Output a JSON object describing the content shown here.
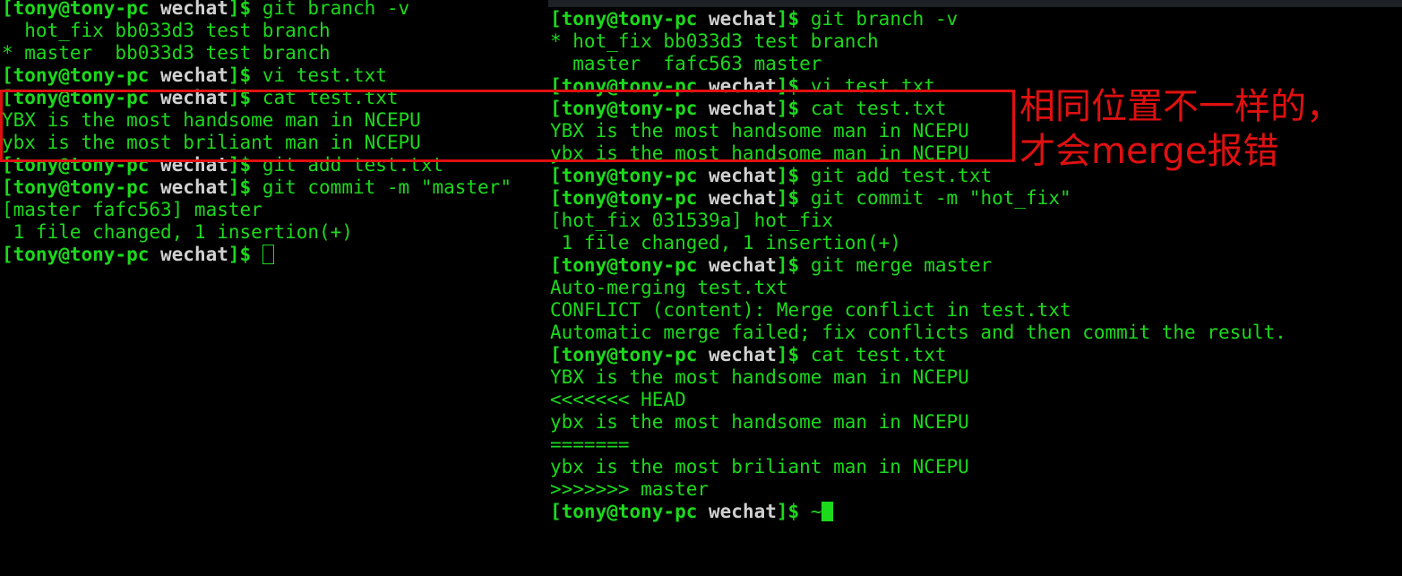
{
  "prompt": {
    "user_host": "[tony@tony-pc ",
    "dir": "wechat",
    "suffix": "]$ "
  },
  "left_terminal": {
    "lines": [
      {
        "type": "prompt",
        "cmd": "git branch -v"
      },
      {
        "type": "out",
        "text": "  hot_fix bb033d3 test branch"
      },
      {
        "type": "out",
        "text": "* master  bb033d3 test branch"
      },
      {
        "type": "prompt",
        "cmd": "vi test.txt"
      },
      {
        "type": "prompt",
        "cmd": "cat test.txt"
      },
      {
        "type": "out",
        "text": "YBX is the most handsome man in NCEPU"
      },
      {
        "type": "out",
        "text": "ybx is the most briliant man in NCEPU"
      },
      {
        "type": "prompt",
        "cmd": "git add test.txt"
      },
      {
        "type": "prompt",
        "cmd": "git commit -m \"master\""
      },
      {
        "type": "out",
        "text": "[master fafc563] master"
      },
      {
        "type": "out",
        "text": " 1 file changed, 1 insertion(+)"
      },
      {
        "type": "prompt",
        "cmd": "",
        "cursor": "hollow"
      }
    ]
  },
  "right_terminal": {
    "lines": [
      {
        "type": "prompt",
        "cmd": "git branch -v"
      },
      {
        "type": "out",
        "text": "* hot_fix bb033d3 test branch"
      },
      {
        "type": "out",
        "text": "  master  fafc563 master"
      },
      {
        "type": "prompt",
        "cmd": "vi test.txt"
      },
      {
        "type": "prompt",
        "cmd": "cat test.txt"
      },
      {
        "type": "out",
        "text": "YBX is the most handsome man in NCEPU"
      },
      {
        "type": "out",
        "text": "ybx is the most handsome man in NCEPU"
      },
      {
        "type": "prompt",
        "cmd": "git add test.txt"
      },
      {
        "type": "prompt",
        "cmd": "git commit -m \"hot_fix\""
      },
      {
        "type": "out",
        "text": "[hot_fix 031539a] hot_fix"
      },
      {
        "type": "out",
        "text": " 1 file changed, 1 insertion(+)"
      },
      {
        "type": "prompt",
        "cmd": "git merge master"
      },
      {
        "type": "out",
        "text": "Auto-merging test.txt"
      },
      {
        "type": "out",
        "text": "CONFLICT (content): Merge conflict in test.txt"
      },
      {
        "type": "out",
        "text": "Automatic merge failed; fix conflicts and then commit the result."
      },
      {
        "type": "prompt",
        "cmd": "cat test.txt"
      },
      {
        "type": "out",
        "text": "YBX is the most handsome man in NCEPU"
      },
      {
        "type": "out",
        "text": "<<<<<<< HEAD"
      },
      {
        "type": "out",
        "text": "ybx is the most handsome man in NCEPU"
      },
      {
        "type": "out",
        "text": "======="
      },
      {
        "type": "out",
        "text": "ybx is the most briliant man in NCEPU"
      },
      {
        "type": "out",
        "text": ">>>>>>> master"
      },
      {
        "type": "prompt",
        "cmd": "~",
        "cursor": "block"
      }
    ]
  },
  "annotation": {
    "line1": "相同位置不一样的，",
    "line2": "才会merge报错",
    "color": "#e01010"
  },
  "colors": {
    "terminal_text": "#1cd91c",
    "prompt_dir": "#d0d0d0",
    "background": "#000000"
  }
}
